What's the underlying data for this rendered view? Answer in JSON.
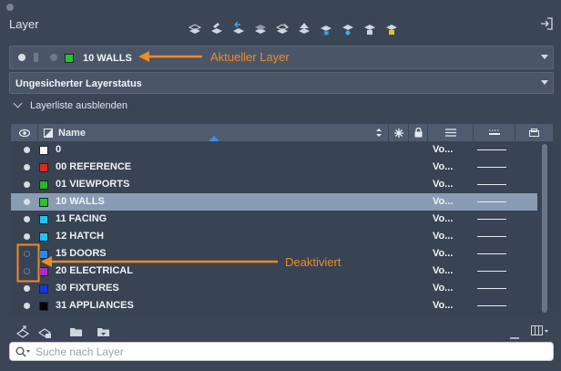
{
  "panel": {
    "title": "Layer"
  },
  "current_layer": {
    "name": "10 WALLS",
    "color": "#2ac52a"
  },
  "layer_state": {
    "value": "Ungesicherter Layerstatus"
  },
  "collapse": {
    "label": "Layerliste ausblenden"
  },
  "table": {
    "name_header": "Name",
    "rows": [
      {
        "name": "0",
        "color": "#ffffff",
        "on": true,
        "linetype": "Vo...",
        "selected": false
      },
      {
        "name": "00 REFERENCE",
        "color": "#e0281e",
        "on": true,
        "linetype": "Vo...",
        "selected": false
      },
      {
        "name": "01 VIEWPORTS",
        "color": "#2bb52b",
        "on": true,
        "linetype": "Vo...",
        "selected": false
      },
      {
        "name": "10 WALLS",
        "color": "#2ac52a",
        "on": true,
        "linetype": "Vo...",
        "selected": true
      },
      {
        "name": "11 FACING",
        "color": "#21c3f0",
        "on": true,
        "linetype": "Vo...",
        "selected": false
      },
      {
        "name": "12 HATCH",
        "color": "#21c3f0",
        "on": true,
        "linetype": "Vo...",
        "selected": false
      },
      {
        "name": "15 DOORS",
        "color": "#1f8ff5",
        "on": false,
        "linetype": "Vo...",
        "selected": false
      },
      {
        "name": "20 ELECTRICAL",
        "color": "#b02cc4",
        "on": false,
        "linetype": "Vo...",
        "selected": false
      },
      {
        "name": "30 FIXTURES",
        "color": "#1038e6",
        "on": true,
        "linetype": "Vo...",
        "selected": false
      },
      {
        "name": "31 APPLIANCES",
        "color": "#050505",
        "on": true,
        "linetype": "Vo...",
        "selected": false
      }
    ]
  },
  "annotations": {
    "current": "Aktueller Layer",
    "disabled": "Deaktiviert",
    "accent": "#f08a24"
  },
  "search": {
    "placeholder": "Suche nach Layer"
  },
  "icons": {
    "toolbar": [
      "layer-properties-icon",
      "layer-match-icon",
      "layer-previous-icon",
      "layer-isolate-icon",
      "layer-unisolate-icon",
      "layer-off-icon",
      "layer-freeze-icon",
      "layer-on-icon",
      "layer-lock-icon",
      "layer-unlock-icon"
    ]
  }
}
